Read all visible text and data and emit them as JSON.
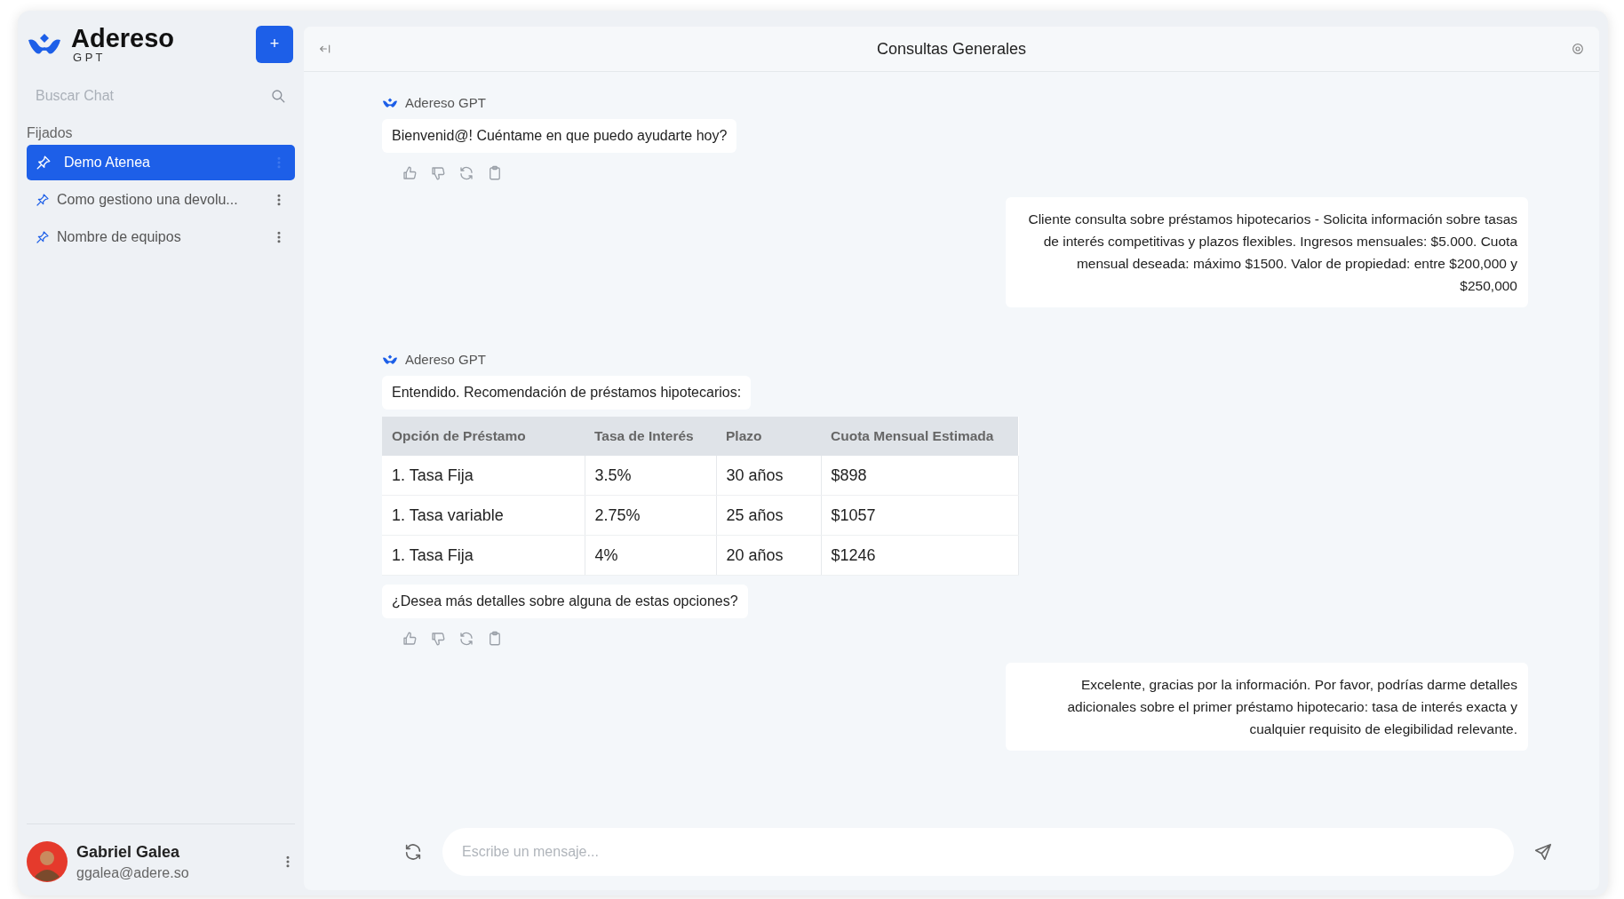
{
  "sidebar": {
    "brand": {
      "name": "Adereso",
      "subtitle": "G P T"
    },
    "new_chat_button": "+",
    "search": {
      "placeholder": "Buscar Chat"
    },
    "section_label": "Fijados",
    "chats": [
      {
        "title": "Demo Atenea",
        "selected": true
      },
      {
        "title": "Como gestiono una devolu...",
        "selected": false
      },
      {
        "title": "Nombre de equipos",
        "selected": false
      }
    ],
    "user": {
      "name": "Gabriel Galea",
      "email": "ggalea@adere.so"
    }
  },
  "header": {
    "title": "Consultas Generales"
  },
  "messages": [
    {
      "kind": "bot",
      "sender": "Adereso GPT",
      "parts": [
        {
          "kind": "text",
          "text": "Bienvenid@! Cuéntame en que puedo ayudarte hoy?"
        }
      ]
    },
    {
      "kind": "user",
      "text": "Cliente consulta sobre préstamos hipotecarios - Solicita información sobre tasas de interés competitivas y plazos flexibles.  Ingresos mensuales: $5.000. Cuota mensual deseada: máximo $1500. Valor de propiedad: entre $200,000 y $250,000"
    },
    {
      "kind": "bot",
      "sender": "Adereso GPT",
      "parts": [
        {
          "kind": "text",
          "text": "Entendido. Recomendación de préstamos hipotecarios:"
        },
        {
          "kind": "table",
          "columns": [
            "Opción de Préstamo",
            "Tasa de Interés",
            "Plazo",
            "Cuota Mensual Estimada"
          ],
          "rows": [
            [
              "1. Tasa Fija",
              "3.5%",
              "30 años",
              "$898"
            ],
            [
              "1. Tasa variable",
              "2.75%",
              "25 años",
              "$1057"
            ],
            [
              "1. Tasa Fija",
              "4%",
              "20 años",
              "$1246"
            ]
          ]
        },
        {
          "kind": "text",
          "text": "¿Desea más detalles sobre alguna de estas opciones?"
        }
      ]
    },
    {
      "kind": "user",
      "text": "Excelente, gracias por la información. Por favor, podrías darme detalles adicionales sobre el primer préstamo hipotecario: tasa de interés exacta y cualquier requisito de elegibilidad relevante."
    }
  ],
  "composer": {
    "placeholder": "Escribe un mensaje..."
  }
}
